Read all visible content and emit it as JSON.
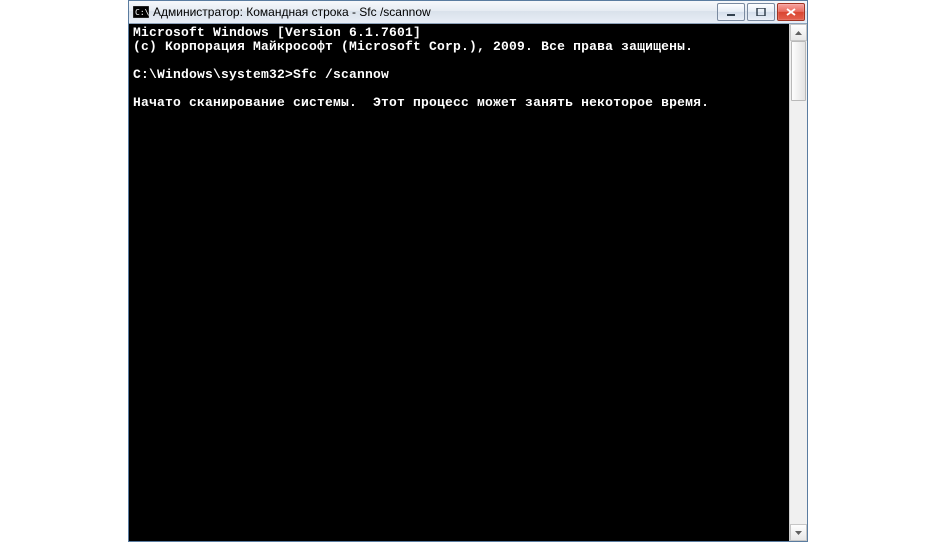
{
  "titlebar": {
    "title": "Администратор: Командная строка - Sfc  /scannow"
  },
  "console": {
    "line1": "Microsoft Windows [Version 6.1.7601]",
    "line2": "(c) Корпорация Майкрософт (Microsoft Corp.), 2009. Все права защищены.",
    "blank1": "",
    "prompt": "C:\\Windows\\system32>",
    "command": "Sfc /scannow",
    "blank2": "",
    "status": "Начато сканирование системы.  Этот процесс может занять некоторое время."
  }
}
